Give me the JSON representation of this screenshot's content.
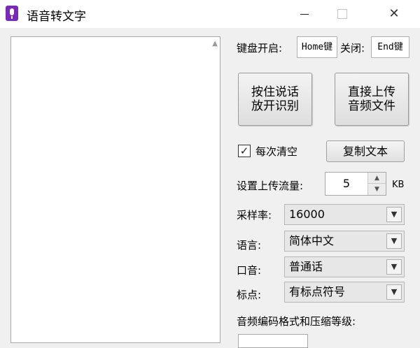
{
  "window": {
    "title": "语音转文字",
    "min_glyph": "—",
    "close_glyph": "✕"
  },
  "hotkeys": {
    "open_label": "键盘开启:",
    "open_value": "Home键",
    "close_label": "关闭:",
    "close_value": "End键"
  },
  "buttons": {
    "hold_to_talk_line1": "按住说话",
    "hold_to_talk_line2": "放开识别",
    "upload_line1": "直接上传",
    "upload_line2": "音频文件",
    "copy_text": "复制文本"
  },
  "clear_each_time": {
    "label": "每次清空",
    "checked": true,
    "check_glyph": "✓"
  },
  "upload_rate": {
    "label": "设置上传流量:",
    "value": "5",
    "unit": "KB"
  },
  "sample_rate": {
    "label": "采样率:",
    "value": "16000"
  },
  "language": {
    "label": "语言:",
    "value": "简体中文"
  },
  "accent": {
    "label": "口音:",
    "value": "普通话"
  },
  "punctuation": {
    "label": "标点:",
    "value": "有标点符号"
  },
  "encoding": {
    "label": "音频编码格式和压缩等级:"
  }
}
